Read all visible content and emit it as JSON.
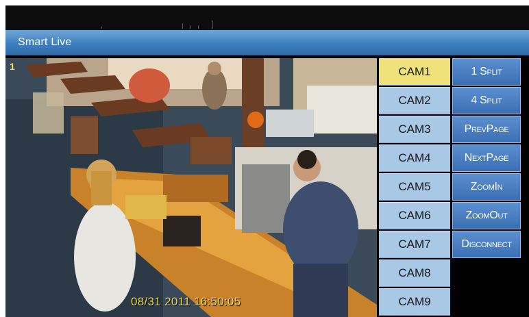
{
  "window": {
    "title": "Smart Live"
  },
  "video": {
    "channel_number": "1",
    "timestamp": "08/31 2011 16:50:05"
  },
  "camera_buttons": [
    {
      "label": "CAM1",
      "selected": true
    },
    {
      "label": "CAM2",
      "selected": false
    },
    {
      "label": "CAM3",
      "selected": false
    },
    {
      "label": "CAM4",
      "selected": false
    },
    {
      "label": "CAM5",
      "selected": false
    },
    {
      "label": "CAM6",
      "selected": false
    },
    {
      "label": "CAM7",
      "selected": false
    },
    {
      "label": "CAM8",
      "selected": false
    },
    {
      "label": "CAM9",
      "selected": false
    }
  ],
  "function_buttons": [
    {
      "label": "1 Split"
    },
    {
      "label": "4 Split"
    },
    {
      "label": "PrevPage"
    },
    {
      "label": "NextPage"
    },
    {
      "label": "ZoomIn"
    },
    {
      "label": "ZoomOut"
    },
    {
      "label": "Disconnect"
    }
  ],
  "colors": {
    "titlebar": "#3f7fbf",
    "cam_button": "#a9c8e6",
    "cam_button_selected": "#f0e27a",
    "function_button": "#3b6fb4",
    "timestamp": "#e9d64a"
  }
}
